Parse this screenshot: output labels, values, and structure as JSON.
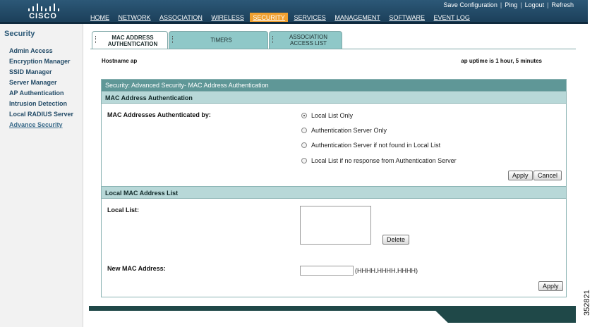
{
  "brand": {
    "logo_text": "CISCO"
  },
  "utility_links": [
    "Save Configuration",
    "Ping",
    "Logout",
    "Refresh"
  ],
  "nav": {
    "items": [
      "HOME",
      "NETWORK",
      "ASSOCIATION",
      "WIRELESS",
      "SECURITY",
      "SERVICES",
      "MANAGEMENT",
      "SOFTWARE",
      "EVENT LOG"
    ],
    "active": "SECURITY"
  },
  "sidebar": {
    "title": "Security",
    "items": [
      "Admin Access",
      "Encryption Manager",
      "SSID Manager",
      "Server Manager",
      "AP Authentication",
      "Intrusion Detection",
      "Local RADIUS Server",
      "Advance Security"
    ],
    "current": "Advance Security"
  },
  "tabs": [
    {
      "label": "MAC ADDRESS AUTHENTICATION",
      "active": true
    },
    {
      "label": "TIMERS",
      "active": false
    },
    {
      "label": "ASSOCIATION ACCESS LIST",
      "active": false
    }
  ],
  "host": {
    "hostname_text": "Hostname  ap",
    "uptime_text": "ap uptime is 1 hour, 5 minutes"
  },
  "panel": {
    "header": "Security: Advanced Security- MAC Address Authentication",
    "auth_section": {
      "title": "MAC Address Authentication",
      "field_label": "MAC Addresses Authenticated by:",
      "options": [
        {
          "label": "Local List Only",
          "selected": true
        },
        {
          "label": "Authentication Server Only",
          "selected": false
        },
        {
          "label": "Authentication Server if not found in Local List",
          "selected": false
        },
        {
          "label": "Local List if no response from Authentication Server",
          "selected": false
        }
      ],
      "apply_label": "Apply",
      "cancel_label": "Cancel"
    },
    "list_section": {
      "title": "Local MAC Address List",
      "local_list_label": "Local List:",
      "delete_label": "Delete",
      "new_mac_label": "New MAC Address:",
      "new_mac_value": "",
      "format_hint": "(HHHH.HHHH.HHHH)",
      "apply_label": "Apply"
    }
  },
  "figure_number": "352821",
  "colors": {
    "header_bg": "#1f4663",
    "nav_active": "#f0a030",
    "panel_header": "#5f9797",
    "section_header": "#b8d8d8",
    "tab_inactive": "#8fc8c8",
    "footer_bar": "#1f4848"
  }
}
